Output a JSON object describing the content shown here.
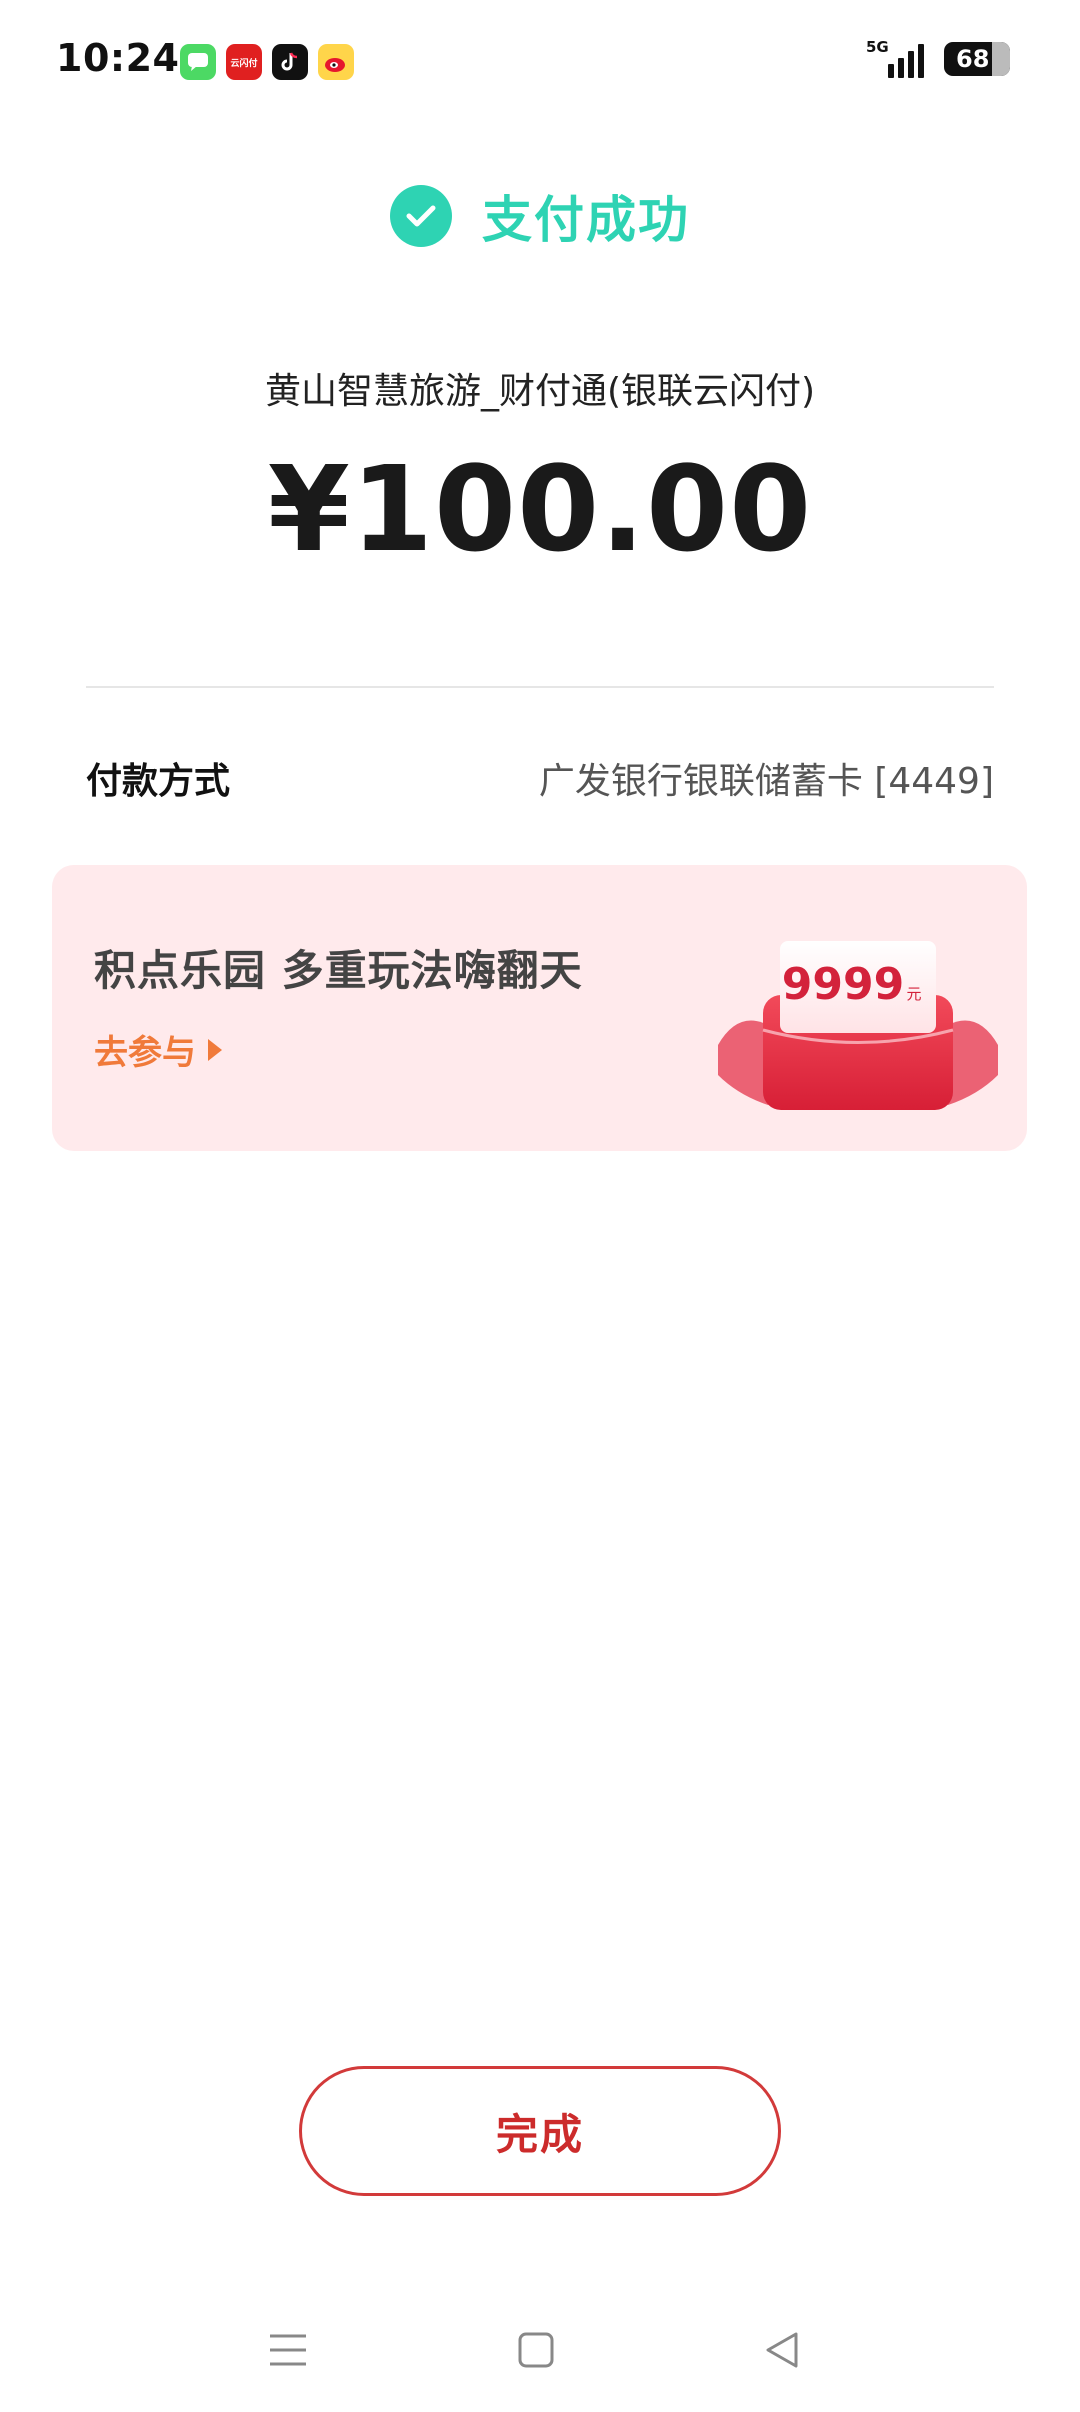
{
  "status_bar": {
    "time": "10:24",
    "network": "5G",
    "battery": "68",
    "notification_apps": [
      "messages-app-icon",
      "yunshanfu-app-icon",
      "tiktok-app-icon",
      "weibo-app-icon"
    ],
    "yunshanfu_label": "云闪付"
  },
  "result": {
    "title": "支付成功",
    "merchant": "黄山智慧旅游_财付通(银联云闪付)",
    "amount": "¥100.00"
  },
  "payment": {
    "label": "付款方式",
    "value": "广发银行银联储蓄卡 [4449]"
  },
  "promo": {
    "title": "积点乐园 多重玩法嗨翻天",
    "link": "去参与",
    "gift_amount": "9999",
    "gift_unit": "元"
  },
  "done_button": "完成",
  "colors": {
    "success": "#2ed3b3",
    "promo_bg": "#ffeaec",
    "promo_link": "#f07a3a",
    "button_red": "#cc2b2b"
  }
}
